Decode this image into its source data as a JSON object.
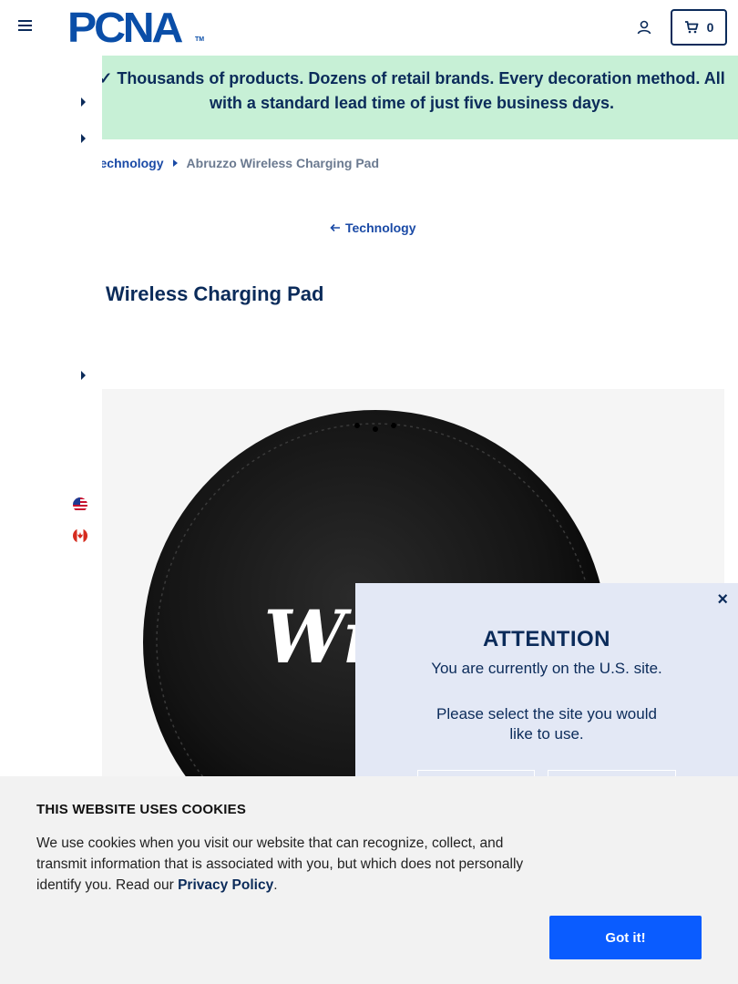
{
  "header": {
    "logo_text": "PCNA",
    "logo_tm": "TM",
    "cart_count": "0"
  },
  "banner": {
    "text": "✓ Thousands of products. Dozens of retail brands. Every decoration method. All with a standard lead time of just five business days."
  },
  "breadcrumb": {
    "parent": "Technology",
    "current": "Abruzzo Wireless Charging Pad"
  },
  "back_link": "Technology",
  "product": {
    "title": "Wireless Charging Pad",
    "imprint": "Wry"
  },
  "rail": {
    "flags": [
      "us-flag-icon",
      "canada-flag-icon"
    ]
  },
  "modal": {
    "close": "×",
    "title": "ATTENTION",
    "line1": "You are currently on the U.S. site.",
    "line2": "Please select the site you would like to use."
  },
  "cookies": {
    "title": "THIS WEBSITE USES COOKIES",
    "body": "We use cookies when you visit our website that can recognize, collect, and transmit information that is associated with you, but which does not personally identify you. Read our ",
    "link": "Privacy Policy",
    "period": ".",
    "button": "Got it!"
  },
  "colors": {
    "navy": "#0b2b5a",
    "brand_blue": "#0a4ea8",
    "banner_bg": "#c7f0d6",
    "button_blue": "#0a5cff",
    "modal_bg": "#e3e8f5"
  }
}
